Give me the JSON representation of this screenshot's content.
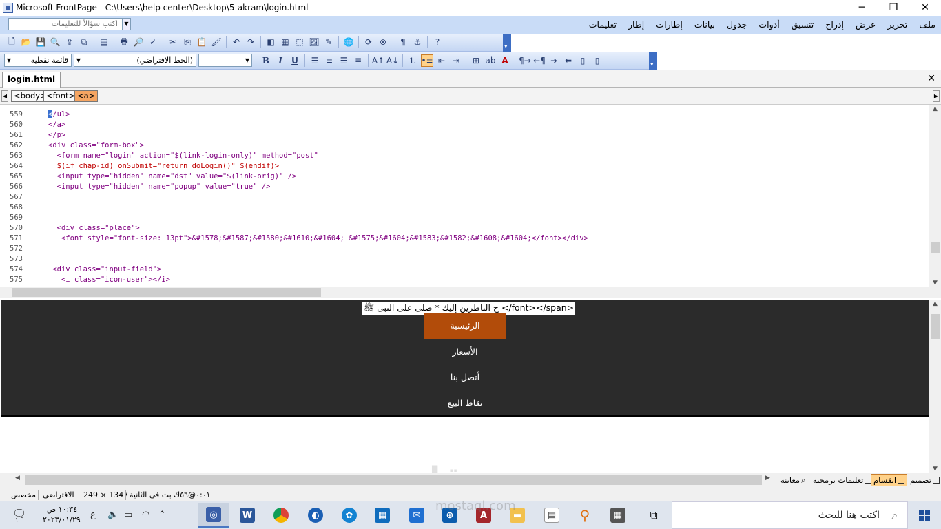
{
  "window": {
    "title": "Microsoft FrontPage - C:\\Users\\help center\\Desktop\\5-akram\\login.html",
    "min": "─",
    "restore": "❐",
    "close": "✕"
  },
  "menubar": {
    "ask_placeholder": "اكتب سؤالاً للتعليمات",
    "items": [
      "ملف",
      "تحرير",
      "عرض",
      "إدراج",
      "تنسيق",
      "أدوات",
      "جدول",
      "بيانات",
      "إطارات",
      "إطار",
      "تعليمات"
    ]
  },
  "toolbar2": {
    "style_value": "قائمة نقطية",
    "font_value": "(الخط الافتراضي)",
    "size_value": "",
    "bold": "B",
    "italic": "I",
    "underline": "U"
  },
  "tabs": {
    "active": "login.html",
    "close": "✕"
  },
  "tag_selector": [
    "<body>",
    "<font>",
    "<a>"
  ],
  "code_lines": [
    {
      "n": "559",
      "t": "</ul>"
    },
    {
      "n": "560",
      "t": "</a>"
    },
    {
      "n": "561",
      "t": "</p>"
    },
    {
      "n": "562",
      "t": "<div class=\"form-box\">"
    },
    {
      "n": "563",
      "t": "  <form name=\"login\" action=\"$(link-login-only)\" method=\"post\""
    },
    {
      "n": "564",
      "t": "  $(if chap-id) onSubmit=\"return doLogin()\" $(endif)>"
    },
    {
      "n": "565",
      "t": "  <input type=\"hidden\" name=\"dst\" value=\"$(link-orig)\" />"
    },
    {
      "n": "566",
      "t": "  <input type=\"hidden\" name=\"popup\" value=\"true\" />"
    },
    {
      "n": "567",
      "t": ""
    },
    {
      "n": "568",
      "t": ""
    },
    {
      "n": "569",
      "t": ""
    },
    {
      "n": "570",
      "t": "  <div class=\"place\">"
    },
    {
      "n": "571",
      "t": "   <font style=\"font-size: 13pt\">&#1578;&#1587;&#1580;&#1610;&#1604; &#1575;&#1604;&#1583;&#1582;&#1608;&#1604;</font></div>"
    },
    {
      "n": "572",
      "t": ""
    },
    {
      "n": "573",
      "t": ""
    },
    {
      "n": "574",
      "t": " <div class=\"input-field\">"
    },
    {
      "n": "575",
      "t": "   <i class=\"icon-user\"></i>"
    }
  ],
  "design": {
    "top_text": "ح الناظرين إليك * صلى على النبى ﷺ  </font></span>",
    "nav_items": [
      "الرئيسية",
      "الأسعار",
      "أتصل بنا",
      "نقاط البيع"
    ]
  },
  "view_tabs": [
    "تصميم",
    "انقسام",
    "تعليمات برمجية",
    "معاينة"
  ],
  "statusbar": {
    "speed": "٠:٠١@٥٦ك بت في الثانية",
    "size": "249 × 1347",
    "default": "الافتراضي",
    "custom": "مخصص"
  },
  "taskbar": {
    "search_placeholder": "اكتب هنا للبحث",
    "time": "١٠:٣٤ ص",
    "date": "٢٠٢٣/٠١/٢٩",
    "lang": "ع",
    "notif": "١"
  },
  "watermark": {
    "logo": "مستقل",
    "url": "mostaql.com"
  },
  "colors": {
    "menubar_bg": "#c9dcf7",
    "nav_active": "#b24c0a",
    "dark_header": "#2b2b2b",
    "tag_selected": "#f5a562"
  }
}
